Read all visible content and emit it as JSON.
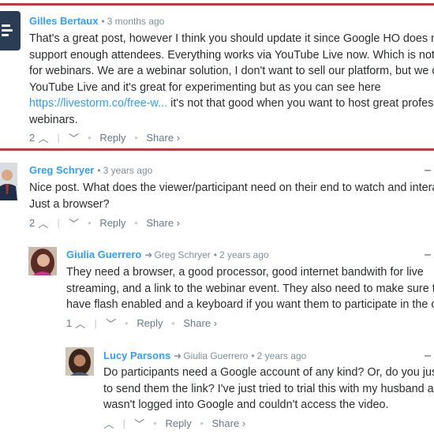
{
  "colors": {
    "highlight_border": "#d92f3a",
    "author": "#2e9fff",
    "link": "#2e9fff",
    "muted": "#7f919e",
    "text": "#2a2e2e"
  },
  "comments": [
    {
      "author": "Gilles Bertaux",
      "timestamp": "3 months ago",
      "avatar_icon": "livestorm-logo-icon",
      "lines": [
        "That's a great post, however I think you should update it since Google HO does n",
        "support enough attendees. Everything works via YouTube Live now. Which is not",
        "for webinars. We are a webinar solution, I don't want to sell our platform, but we d",
        "YouTube Live and it's great for experimenting but as you can see here"
      ],
      "link_text": "https://livestorm.co/free-w...",
      "link_after": " it's not that good when you want to host great profess",
      "last_line": "webinars.",
      "votes": "2",
      "reply_label": "Reply",
      "share_label": "Share ›"
    },
    {
      "author": "Greg Schryer",
      "timestamp": "3 years ago",
      "avatar_icon": "user-avatar-icon",
      "lines": [
        "Nice post. What does the viewer/participant need on their end to watch and intera",
        "Just a browser?"
      ],
      "votes": "2",
      "reply_label": "Reply",
      "share_label": "Share ›"
    },
    {
      "author": "Giulia Guerrero",
      "reply_to": "Greg Schryer",
      "timestamp": "2 years ago",
      "avatar_icon": "user-avatar-icon",
      "lines": [
        "They need a browser, a good processor, good internet bandwith for live",
        "streaming, and a link to the webinar event. They also need to make sure th",
        "have flash enabled and a keyboard if you want them to participate in the c"
      ],
      "votes": "1",
      "reply_label": "Reply",
      "share_label": "Share ›"
    },
    {
      "author": "Lucy Parsons",
      "reply_to": "Giulia Guerrero",
      "timestamp": "2 years ago",
      "avatar_icon": "user-avatar-icon",
      "lines": [
        "Do participants need a Google account of any kind? Or, do you jus",
        "to send them the link? I've just tried to trial this with my husband an",
        "wasn't logged into Google and couldn't access the video."
      ],
      "votes": "",
      "reply_label": "Reply",
      "share_label": "Share ›"
    }
  ]
}
